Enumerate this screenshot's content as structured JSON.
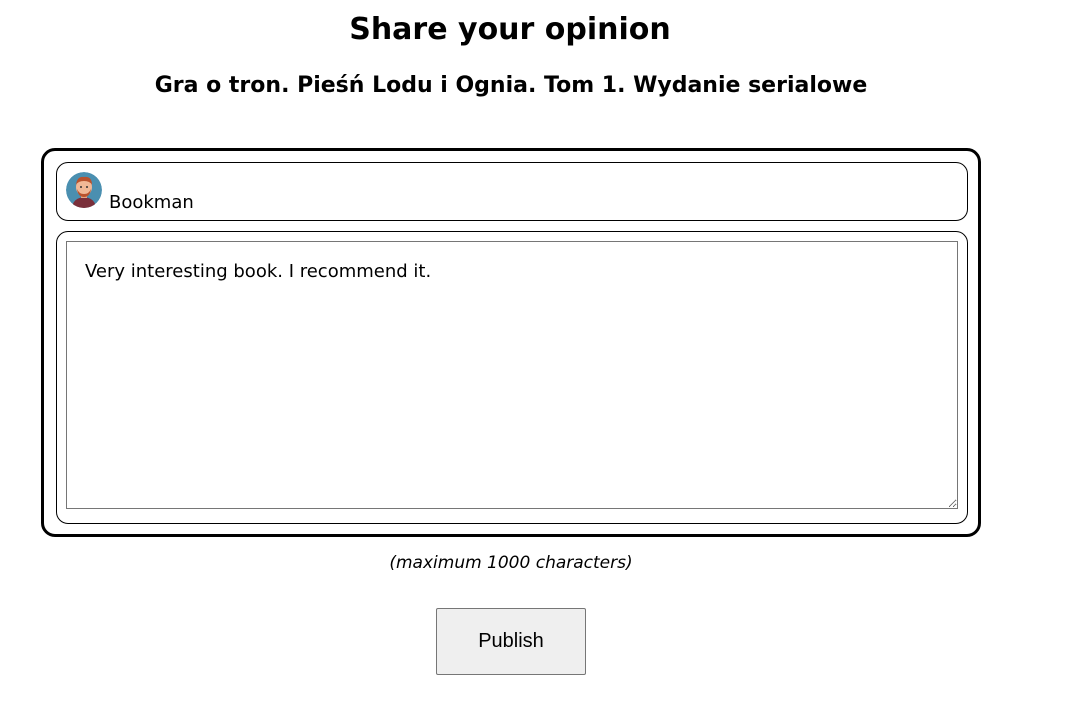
{
  "page": {
    "title": "Share your opinion",
    "book_title": "Gra o tron. Pieśń Lodu i Ognia. Tom 1. Wydanie serialowe"
  },
  "user": {
    "name": "Bookman",
    "avatar_icon": "user-avatar-icon"
  },
  "review": {
    "text": "Very interesting book. I recommend it."
  },
  "hint": "(maximum 1000 characters)",
  "actions": {
    "publish_label": "Publish"
  }
}
